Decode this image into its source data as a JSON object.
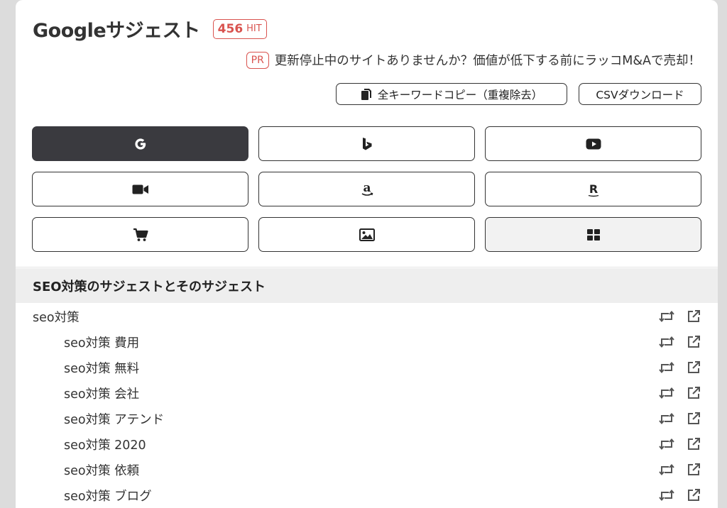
{
  "header": {
    "title": "Googleサジェスト",
    "hit_count": "456",
    "hit_label": "HIT"
  },
  "promo": {
    "badge": "PR",
    "text": "更新停止中のサイトありませんか？価値が低下する前にラッコM&Aで売却！"
  },
  "actions": {
    "copy_all_label": "全キーワードコピー（重複除去）",
    "csv_label": "CSVダウンロード"
  },
  "engines": [
    {
      "icon": "google-icon",
      "active": true
    },
    {
      "icon": "bing-icon",
      "active": false
    },
    {
      "icon": "youtube-icon",
      "active": false
    },
    {
      "icon": "video-icon",
      "active": false
    },
    {
      "icon": "amazon-icon",
      "active": false
    },
    {
      "icon": "rakuten-icon",
      "active": false
    },
    {
      "icon": "shopping-cart-icon",
      "active": false
    },
    {
      "icon": "image-icon",
      "active": false
    },
    {
      "icon": "grid-icon",
      "active": false
    }
  ],
  "section": {
    "title": "SEO対策のサジェストとそのサジェスト"
  },
  "suggestions": [
    {
      "text": "seo対策",
      "level": 0
    },
    {
      "text": "seo対策 費用",
      "level": 1
    },
    {
      "text": "seo対策 無料",
      "level": 1
    },
    {
      "text": "seo対策 会社",
      "level": 1
    },
    {
      "text": "seo対策 アテンド",
      "level": 1
    },
    {
      "text": "seo対策 2020",
      "level": 1
    },
    {
      "text": "seo対策 依頼",
      "level": 1
    },
    {
      "text": "seo対策 ブログ",
      "level": 1
    }
  ],
  "colors": {
    "accent_red": "#d9534f",
    "active_button": "#3a3a3f",
    "section_bg": "#eeeeee"
  }
}
